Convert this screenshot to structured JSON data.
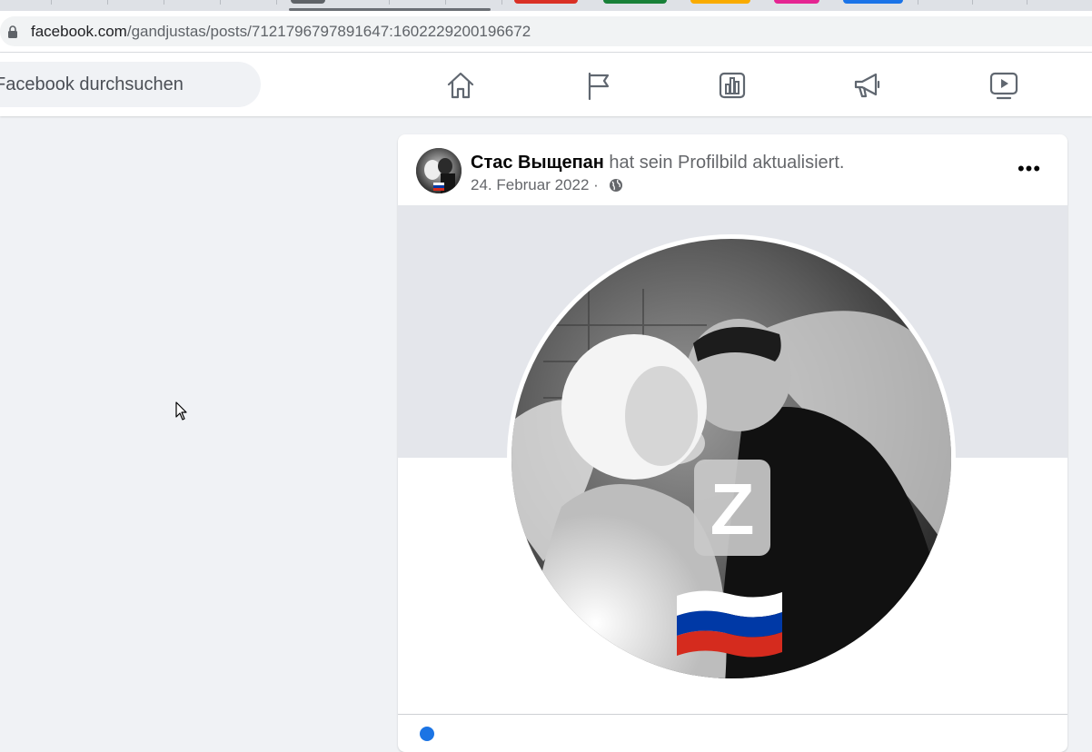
{
  "browser": {
    "url_host": "facebook.com",
    "url_path": "/gandjustas/posts/7121796797891647:1602229200196672",
    "tab_colors": [
      "#d93025",
      "#188038",
      "#f9ab00",
      "#e52592",
      "#1a73e8"
    ]
  },
  "header": {
    "search_placeholder": "Facebook durchsuchen",
    "nav_icons": [
      "home-icon",
      "pages-flag-icon",
      "analytics-icon",
      "megaphone-icon",
      "watch-video-icon"
    ]
  },
  "post": {
    "author": "Стас Выщепан",
    "action": " hat sein Profilbild aktualisiert.",
    "date": "24. Februar 2022",
    "separator": " · ",
    "privacy_icon": "globe-icon",
    "more_label": "•••",
    "image_badge_letter": "Z",
    "flag_colors": [
      "#ffffff",
      "#0039a6",
      "#d52b1e"
    ]
  },
  "colors": {
    "accent": "#1b74e4",
    "page_background": "#f0f2f5"
  }
}
